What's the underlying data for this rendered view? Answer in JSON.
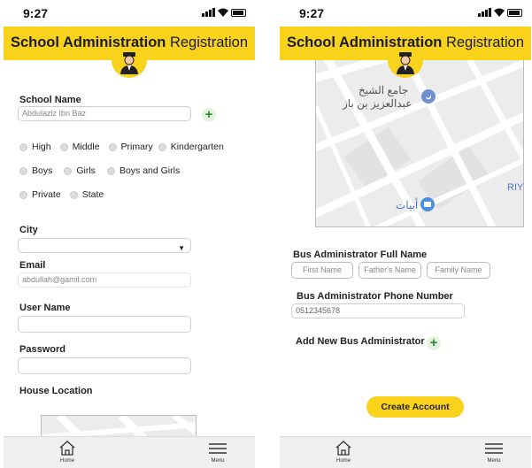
{
  "status": {
    "time": "9:27"
  },
  "header": {
    "title_bold": "School Administration",
    "title_light": "Registration"
  },
  "left_screen": {
    "school_name_label": "School Name",
    "school_name_value": "Abdulaziz Ibn Baz",
    "levels": [
      "High",
      "Middle",
      "Primary",
      "Kindergarten"
    ],
    "genders": [
      "Boys",
      "Girls",
      "Boys and Girls"
    ],
    "types": [
      "Private",
      "State"
    ],
    "city_label": "City",
    "city_value": "",
    "email_label": "Email",
    "email_value": "abdullah@gamil.com",
    "username_label": "User Name",
    "password_label": "Password",
    "house_location_label": "House Location"
  },
  "right_screen": {
    "map_labels": {
      "mosque_line1": "جامع الشيخ",
      "mosque_line2": "عبدالعزيز بن باز",
      "store": "أبيات",
      "riy": "RIY"
    },
    "bus_admin_name_label": "Bus Administrator Full Name",
    "first_name_placeholder": "First Name",
    "father_name_placeholder": "Father's Name",
    "family_name_placeholder": "Family Name",
    "bus_admin_phone_label": "Bus Administrator Phone Number",
    "phone_value": "0512345678",
    "add_bus_admin_label": "Add New Bus Administrator",
    "create_account_label": "Create Account"
  },
  "bottom_nav": {
    "home": "Home",
    "menu": "Menu"
  },
  "colors": {
    "accent": "#f9d21c",
    "plus": "#2e8b2e"
  }
}
